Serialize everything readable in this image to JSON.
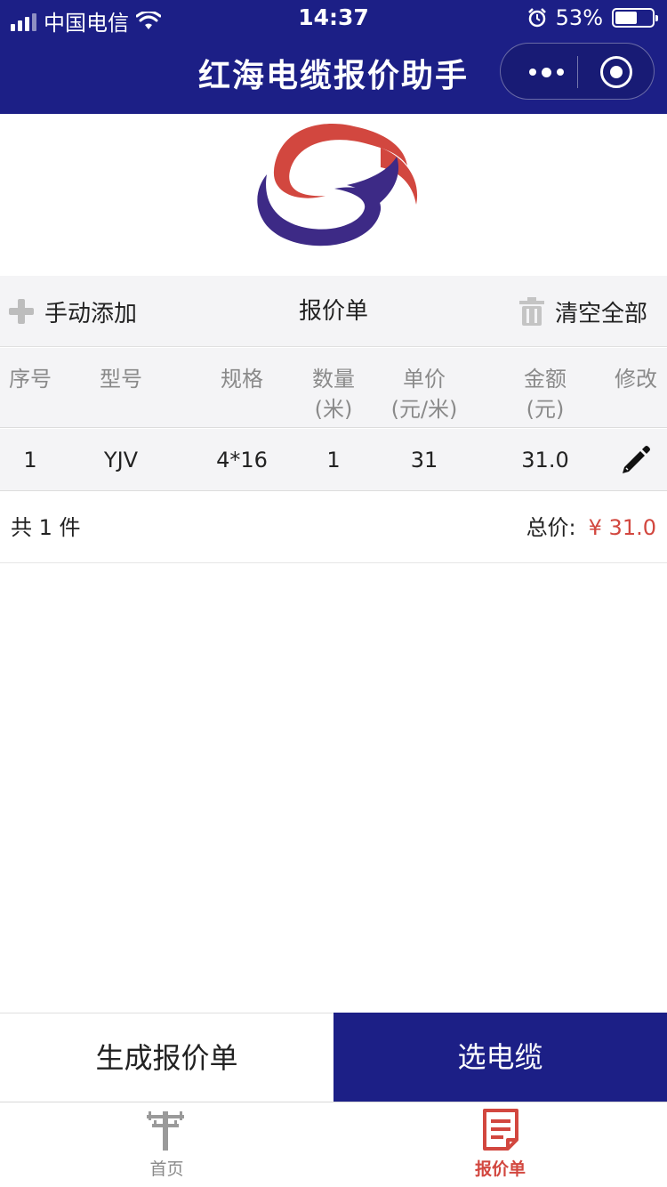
{
  "status_bar": {
    "carrier": "中国电信",
    "time": "14:37",
    "battery_percent": "53%"
  },
  "nav": {
    "title": "红海电缆报价助手"
  },
  "toolbar": {
    "add_label": "手动添加",
    "title": "报价单",
    "clear_label": "清空全部"
  },
  "table": {
    "headers": {
      "index": "序号",
      "model": "型号",
      "spec": "规格",
      "qty": "数量",
      "qty_unit": "(米)",
      "unit_price": "单价",
      "unit_price_unit": "(元/米)",
      "amount": "金额",
      "amount_unit": "(元)",
      "edit": "修改"
    },
    "rows": [
      {
        "index": "1",
        "model": "YJV",
        "spec": "4*16",
        "qty": "1",
        "unit_price": "31",
        "amount": "31.0"
      }
    ]
  },
  "summary": {
    "count_text": "共 1 件",
    "total_label": "总价:",
    "total_value": "¥ 31.0"
  },
  "actions": {
    "generate_label": "生成报价单",
    "select_label": "选电缆"
  },
  "tabbar": {
    "home_label": "首页",
    "quote_label": "报价单"
  },
  "colors": {
    "brand_navy": "#1c1f86",
    "accent_red": "#d2473f",
    "toolbar_bg": "#f4f4f6"
  },
  "icons": {
    "add": "plus-icon",
    "clear": "trash-icon",
    "edit": "pencil-icon",
    "home_tab": "power-pole-icon",
    "quote_tab": "document-icon",
    "nav_more": "more-dots-icon",
    "nav_close": "target-circle-icon"
  }
}
